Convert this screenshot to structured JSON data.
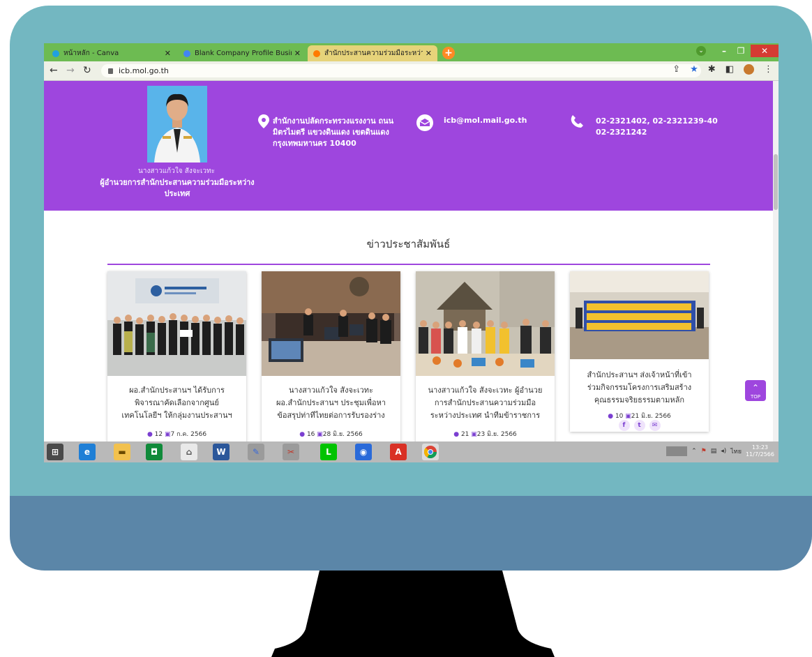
{
  "browser": {
    "tabs": [
      {
        "label": "หน้าหลัก - Canva",
        "favicon_color": "#21a0e0"
      },
      {
        "label": "Blank Company Profile Business",
        "favicon_color": "#4285f4"
      },
      {
        "label": "สำนักประสานความร่วมมือระหว่างประ",
        "favicon_color": "#ff7b00"
      }
    ],
    "url": "icb.mol.go.th"
  },
  "hero": {
    "person_name": "นางสาวแก้วใจ สังจะเวทะ",
    "person_title": "ผู้อำนวยการสำนักประสานความร่วมมือระหว่างประเทศ",
    "address": "สำนักงานปลัดกระทรวงแรงงาน ถนนมิตรไมตรี แขวงดินแดง เขตดินแดง กรุงเทพมหานคร 10400",
    "email": "icb@mol.mail.go.th",
    "phone_line1": "02-2321402, 02-2321239-40",
    "phone_line2": "02-2321242"
  },
  "news": {
    "heading": "ข่าวประชาสัมพันธ์",
    "cards": [
      {
        "title_line1": "ผอ.สำนักประสานฯ ได้รับการ",
        "title_line2": "พิจารณาคัดเลือกจากศูนย์",
        "title_line3": "เทคโนโลยีฯ ให้กลุ่มงานประสานฯ",
        "views": "12",
        "date": "7 ก.ค. 2566"
      },
      {
        "title_line1": "นางสาวแก้วใจ สังจะเวทะ",
        "title_line2": "ผอ.สำนักประสานฯ ประชุมเพื่อหา",
        "title_line3": "ข้อสรุปท่าทีไทยต่อการรับรองร่าง",
        "views": "16",
        "date": "28 มิ.ย. 2566"
      },
      {
        "title_line1": "นางสาวแก้วใจ สังจะเวทะ ผู้อำนวย",
        "title_line2": "การสำนักประสานความร่วมมือ",
        "title_line3": "ระหว่างประเทศ นำทีมข้าราชการ",
        "views": "21",
        "date": "23 มิ.ย. 2566"
      },
      {
        "title_line1": "สำนักประสานฯ ส่งเจ้าหน้าที่เข้า",
        "title_line2": "ร่วมกิจกรรมโครงการเสริมสร้าง",
        "title_line3": "คุณธรรมจริยธรรมตามหลัก",
        "views": "10",
        "date": "21 มิ.ย. 2566"
      }
    ],
    "top_button": "TOP"
  },
  "taskbar": {
    "lang": "ไทย",
    "time": "13:23",
    "date": "11/7/2566"
  },
  "colors": {
    "accent": "#9e46de",
    "monitor_frame": "#73b7c1",
    "monitor_chin": "#5b86a8"
  }
}
